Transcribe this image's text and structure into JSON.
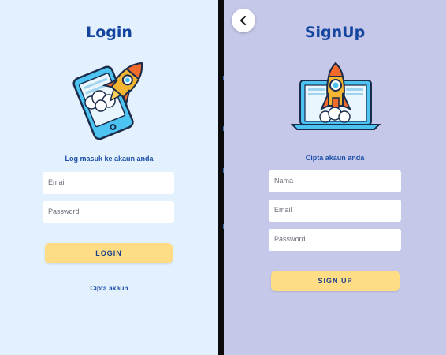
{
  "login": {
    "title": "Login",
    "subtitle": "Log masuk ke akaun anda",
    "email_placeholder": "Email",
    "password_placeholder": "Password",
    "login_button": "LOGIN",
    "create_account_link": "Cipta akaun",
    "illustration_icon": "phone-rocket-icon"
  },
  "signup": {
    "title": "SignUp",
    "subtitle": "Cipta akaun anda",
    "name_placeholder": "Nama",
    "email_placeholder": "Email",
    "password_placeholder": "Password",
    "signup_button": "SIGN UP",
    "back_icon": "chevron-left-icon",
    "illustration_icon": "laptop-rocket-icon"
  },
  "colors": {
    "login_bg": "#e3f0fd",
    "signup_bg": "#c5c8e8",
    "title": "#1446a0",
    "button": "#ffdd85",
    "button_text": "#1d3f8a"
  }
}
